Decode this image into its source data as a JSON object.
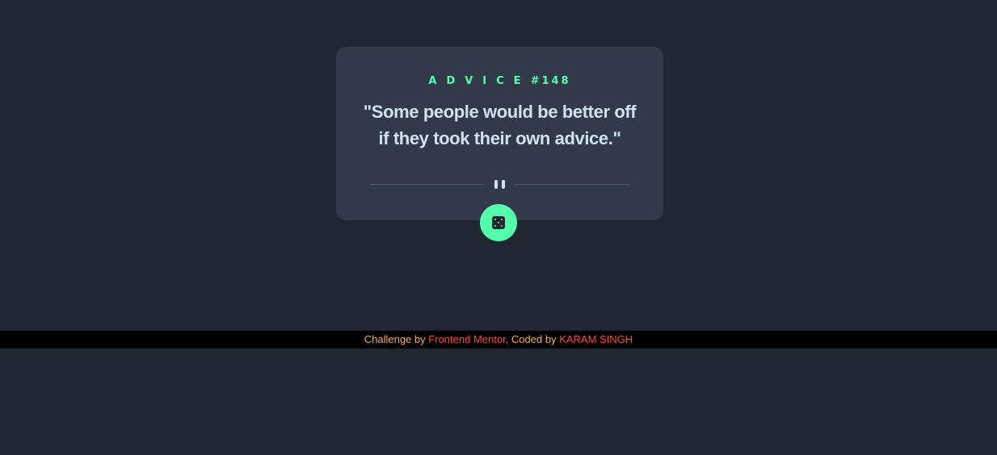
{
  "card": {
    "advice_word": "ADVICE",
    "advice_number": "#148",
    "quote": "\"Some people would be better off if they took their own advice.\""
  },
  "dice_button": {
    "icon": "dice-icon"
  },
  "divider": {
    "icon": "pause-icon"
  },
  "footer": {
    "prefix": "Challenge by ",
    "link1": "Frontend Mentor",
    "middle": ". Coded by ",
    "link2": "KARAM SINGH"
  },
  "colors": {
    "background": "#202632",
    "card": "#323a49",
    "accent": "#53ffaa",
    "quote_text": "#cee3e9",
    "footer_text": "#f0b060",
    "footer_link": "#ff4a3a"
  }
}
